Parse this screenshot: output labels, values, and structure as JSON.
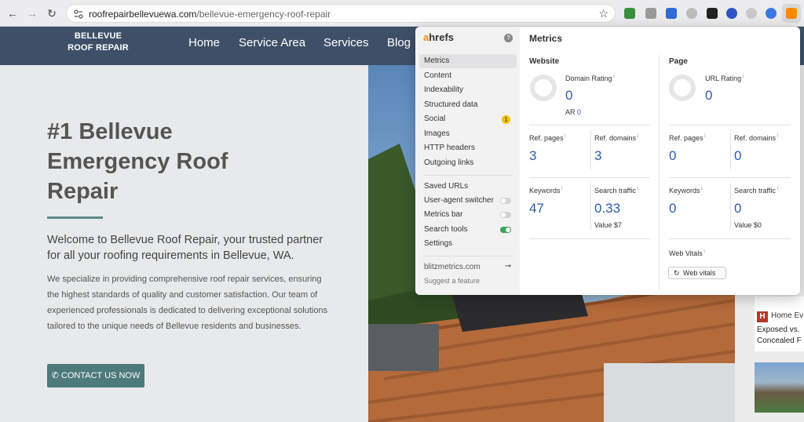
{
  "browser": {
    "url_host": "roofrepairbellevuewa.com",
    "url_path": "/bellevue-emergency-roof-repair"
  },
  "site": {
    "logo_line1": "BELLEVUE",
    "logo_line2": "ROOF REPAIR",
    "menu": [
      "Home",
      "Service Area",
      "Services",
      "Blog"
    ],
    "hero_title": "#1 Bellevue Emergency Roof Repair",
    "hero_lead": "Welcome to Bellevue Roof Repair, your trusted partner for all your roofing requirements in Bellevue, WA.",
    "hero_body": "We specialize in providing comprehensive roof repair services, ensuring the highest standards of quality and customer satisfaction. Our team of experienced professionals is dedicated to delivering exceptional solutions tailored to the unique needs of Bellevue residents and businesses.",
    "cta_label": "CONTACT US NOW",
    "side_brand": "Home Ev",
    "side_text": "Exposed vs. Concealed F",
    "side_h": "H"
  },
  "ahrefs": {
    "logo_a": "a",
    "logo_rest": "hrefs",
    "menu": [
      "Metrics",
      "Content",
      "Indexability",
      "Structured data",
      "Social",
      "Images",
      "HTTP headers",
      "Outgoing links"
    ],
    "social_badge": "1",
    "tools": [
      "Saved URLs",
      "User-agent switcher",
      "Metrics bar",
      "Search tools",
      "Settings"
    ],
    "account": "blitzmetrics.com",
    "suggest": "Suggest a feature",
    "title": "Metrics",
    "website": {
      "heading": "Website",
      "domain_rating_label": "Domain Rating",
      "domain_rating": "0",
      "ar_label": "AR",
      "ar_value": "0",
      "ref_pages_label": "Ref. pages",
      "ref_pages": "3",
      "ref_domains_label": "Ref. domains",
      "ref_domains": "3",
      "keywords_label": "Keywords",
      "keywords": "47",
      "traffic_label": "Search traffic",
      "traffic": "0.33",
      "value_label": "Value $7"
    },
    "page": {
      "heading": "Page",
      "url_rating_label": "URL Rating",
      "url_rating": "0",
      "ref_pages_label": "Ref. pages",
      "ref_pages": "0",
      "ref_domains_label": "Ref. domains",
      "ref_domains": "0",
      "keywords_label": "Keywords",
      "keywords": "0",
      "traffic_label": "Search traffic",
      "traffic": "0",
      "value_label": "Value $0",
      "web_vitals_label": "Web Vitals",
      "web_vitals_button": "Web vitals"
    }
  }
}
